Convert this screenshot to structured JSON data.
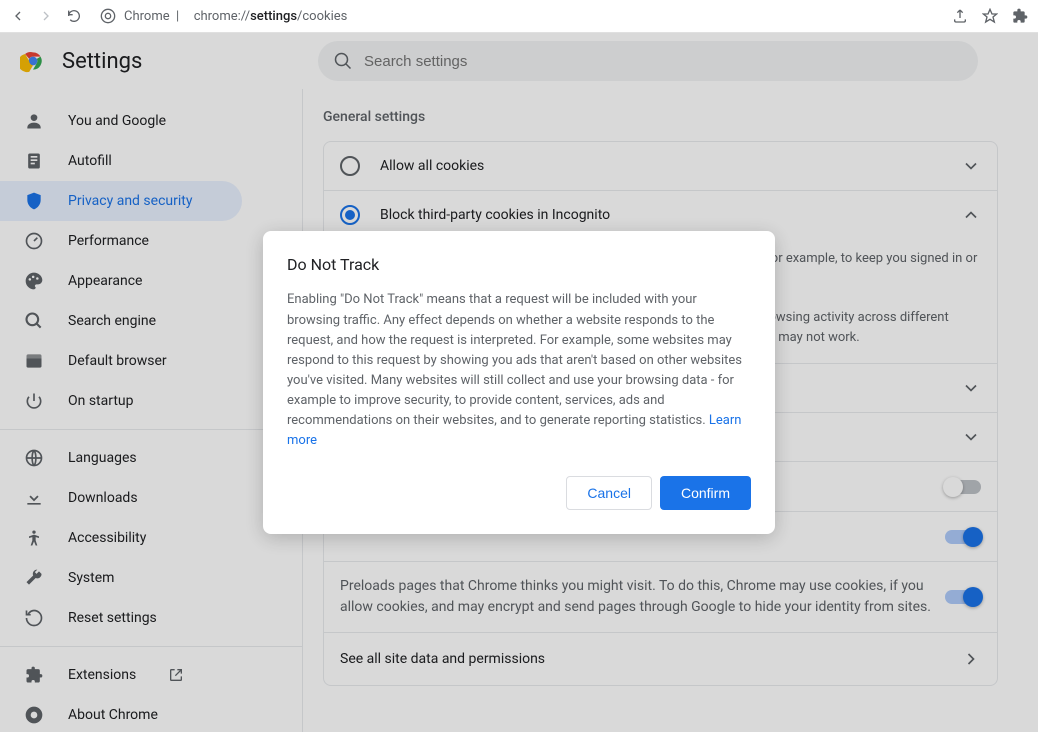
{
  "browser": {
    "label": "Chrome",
    "url_prefix": "chrome://",
    "url_bold": "settings",
    "url_suffix": "/cookies"
  },
  "header": {
    "title": "Settings",
    "search_placeholder": "Search settings"
  },
  "sidebar": {
    "items": [
      {
        "label": "You and Google",
        "icon": "person"
      },
      {
        "label": "Autofill",
        "icon": "autofill"
      },
      {
        "label": "Privacy and security",
        "icon": "shield",
        "active": true
      },
      {
        "label": "Performance",
        "icon": "speed"
      },
      {
        "label": "Appearance",
        "icon": "palette"
      },
      {
        "label": "Search engine",
        "icon": "search"
      },
      {
        "label": "Default browser",
        "icon": "browser"
      },
      {
        "label": "On startup",
        "icon": "power"
      }
    ],
    "items2": [
      {
        "label": "Languages",
        "icon": "globe"
      },
      {
        "label": "Downloads",
        "icon": "download"
      },
      {
        "label": "Accessibility",
        "icon": "accessibility"
      },
      {
        "label": "System",
        "icon": "wrench"
      },
      {
        "label": "Reset settings",
        "icon": "restore"
      }
    ],
    "items3": [
      {
        "label": "Extensions",
        "icon": "extension",
        "external": true
      },
      {
        "label": "About Chrome",
        "icon": "chrome"
      }
    ]
  },
  "content": {
    "section_title": "General settings",
    "option1": "Allow all cookies",
    "option2": "Block third-party cookies in Incognito",
    "detail1": "Sites can use cookies to improve your browsing experience, for example, to keep you signed in or to remember items in your shopping cart",
    "detail2": "While in Incognito, sites can't use your cookies to see your browsing activity across different sites, for example, to personalize ads. Features on some sites may not work.",
    "preload_text": "Preloads pages that Chrome thinks you might visit. To do this, Chrome may use cookies, if you allow cookies, and may encrypt and send pages through Google to hide your identity from sites.",
    "see_all": "See all site data and permissions"
  },
  "dialog": {
    "title": "Do Not Track",
    "body": "Enabling \"Do Not Track\" means that a request will be included with your browsing traffic. Any effect depends on whether a website responds to the request, and how the request is interpreted. For example, some websites may respond to this request by showing you ads that aren't based on other websites you've visited. Many websites will still collect and use your browsing data - for example to improve security, to provide content, services, ads and recommendations on their websites, and to generate reporting statistics. ",
    "learn_more": "Learn more",
    "cancel": "Cancel",
    "confirm": "Confirm"
  }
}
